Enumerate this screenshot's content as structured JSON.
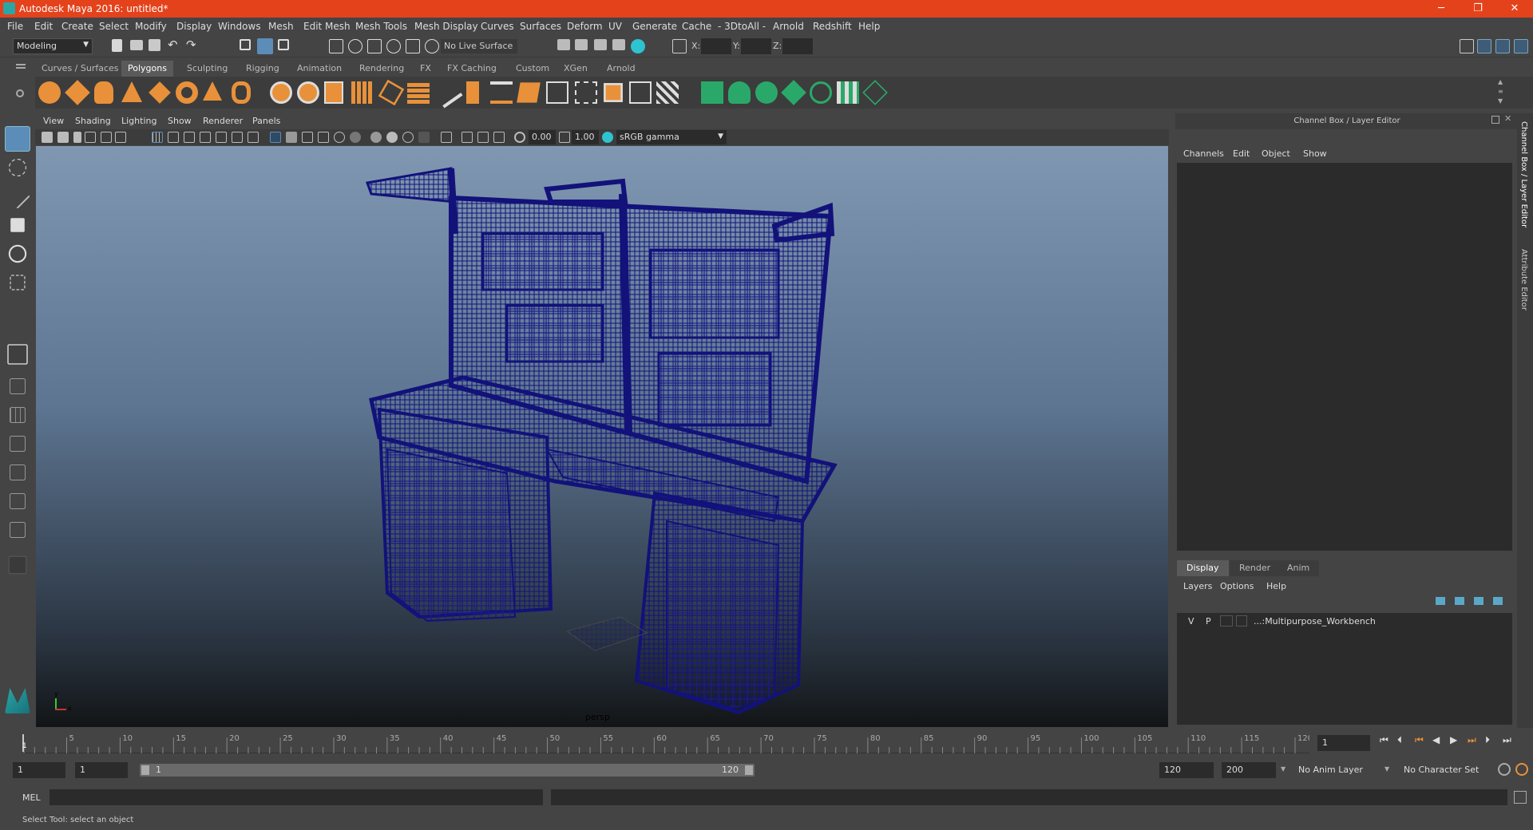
{
  "window": {
    "title": "Autodesk Maya 2016: untitled*",
    "minimize_icon": "─",
    "restore_icon": "❐",
    "close_icon": "✕"
  },
  "menu": [
    "File",
    "Edit",
    "Create",
    "Select",
    "Modify",
    "Display",
    "Windows",
    "Mesh",
    "Edit Mesh",
    "Mesh Tools",
    "Mesh Display",
    "Curves",
    "Surfaces",
    "Deform",
    "UV",
    "Generate",
    "Cache",
    "- 3DtoAll -",
    "Arnold",
    "Redshift",
    "Help"
  ],
  "status_line": {
    "mode": "Modeling",
    "live_surface": "No Live Surface",
    "x_label": "X:",
    "y_label": "Y:",
    "z_label": "Z:"
  },
  "shelf_tabs": [
    "Curves / Surfaces",
    "Polygons",
    "Sculpting",
    "Rigging",
    "Animation",
    "Rendering",
    "FX",
    "FX Caching",
    "Custom",
    "XGen",
    "Arnold"
  ],
  "active_shelf_tab": "Polygons",
  "viewport": {
    "menus": [
      "View",
      "Shading",
      "Lighting",
      "Show",
      "Renderer",
      "Panels"
    ],
    "exposure": "0.00",
    "gamma": "1.00",
    "color_space": "sRGB gamma",
    "camera_label": "persp",
    "axis_x": "x",
    "axis_y": "y"
  },
  "channel_box": {
    "title": "Channel Box / Layer Editor",
    "menus": [
      "Channels",
      "Edit",
      "Object",
      "Show"
    ]
  },
  "layer_editor": {
    "tabs": [
      "Display",
      "Render",
      "Anim"
    ],
    "active_tab": "Display",
    "menus": [
      "Layers",
      "Options",
      "Help"
    ],
    "layers": [
      {
        "v": "V",
        "p": "P",
        "name": "...:Multipurpose_Workbench"
      }
    ]
  },
  "side_tabs": [
    "Channel Box / Layer Editor",
    "Attribute Editor"
  ],
  "timeline": {
    "ticks": [
      5,
      10,
      15,
      20,
      25,
      30,
      35,
      40,
      45,
      50,
      55,
      60,
      65,
      70,
      75,
      80,
      85,
      90,
      95,
      100,
      105,
      110,
      115,
      120
    ],
    "current_frame_marker": "1",
    "current_frame_field": "1"
  },
  "range": {
    "start": "1",
    "playback_start": "1",
    "slider_start": "1",
    "slider_end": "120",
    "playback_end": "120",
    "end": "200",
    "anim_layer": "No Anim Layer",
    "character_set": "No Character Set"
  },
  "command_line": {
    "label": "MEL"
  },
  "help_line": "Select Tool: select an object",
  "colors": {
    "title_bar": "#e4421b",
    "wire": "#12127a",
    "accent": "#e8913a"
  }
}
